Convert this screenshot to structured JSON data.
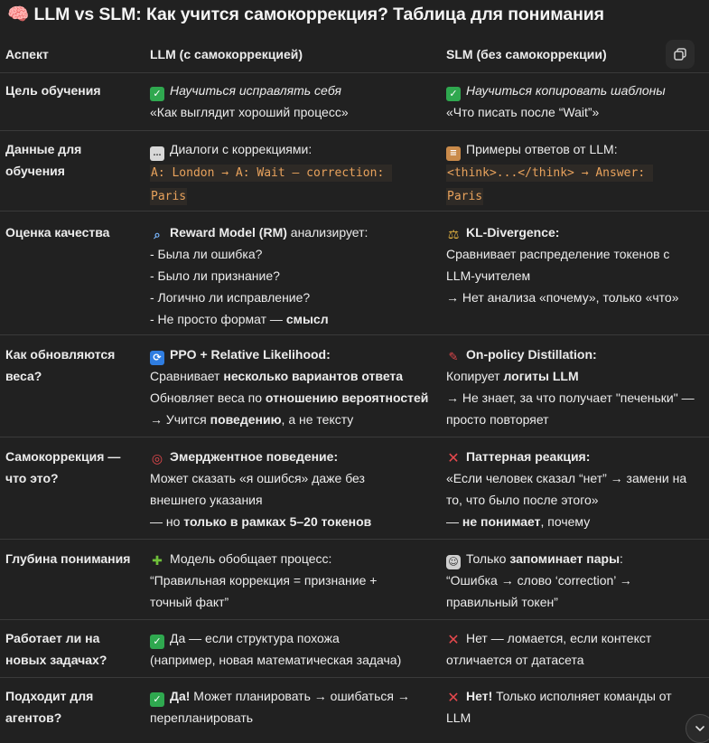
{
  "title": "🧠 LLM vs SLM: Как учится самокоррекция? Таблица для понимания",
  "header": {
    "aspect": "Аспект",
    "llm": "LLM (с самокоррекцией)",
    "slm": "SLM (без самокоррекции)"
  },
  "icons": {
    "copy": "copy-icon",
    "scroll_down": "chevron-down-icon"
  },
  "rows": [
    {
      "aspect": [
        "Цель обучения"
      ],
      "llm": {
        "icon": "✓",
        "line1": "Научиться исправлять себя",
        "line2": "«Как выглядит хороший процесс»"
      },
      "slm": {
        "icon": "✓",
        "line1": "Научиться копировать шаблоны",
        "line2": "«Что писать после “Wait”»"
      }
    },
    {
      "aspect": [
        "Данные для",
        "обучения"
      ],
      "llm": {
        "icon": "…",
        "line1": "Диалоги с коррекциями:",
        "code1": "A: London → A: Wait — correction: ",
        "code2": "Paris"
      },
      "slm": {
        "icon": "≡",
        "line1": "Примеры ответов от LLM:",
        "code1": "<think>...</think> → Answer: ",
        "code2": "Paris"
      }
    },
    {
      "aspect": [
        "Оценка качества"
      ],
      "llm": {
        "icon": "⌕",
        "head_bold": "Reward Model (RM)",
        "head_rest": " анализирует:",
        "l2": "- Была ли ошибка?",
        "l3": "- Было ли признание?",
        "l4": "- Логично ли исправление?",
        "l5a": "- Не просто формат — ",
        "l5b": "смысл"
      },
      "slm": {
        "icon": "⚖",
        "head_bold": "KL-Divergence:",
        "l2": "Сравнивает распределение токенов с",
        "l3": "LLM-учителем",
        "l4": "→ Нет анализа «почему», только «что»"
      }
    },
    {
      "aspect": [
        "Как обновляются",
        "веса?"
      ],
      "llm": {
        "icon": "⟳",
        "head_bold": "PPO + Relative Likelihood:",
        "l2a": "Сравнивает ",
        "l2b": "несколько вариантов ответа",
        "l3a": "Обновляет веса по ",
        "l3b": "отношению вероятностей",
        "l4a": "→ Учится ",
        "l4b": "поведению",
        "l4c": ", а не тексту"
      },
      "slm": {
        "icon": "✎",
        "head_bold": "On-policy Distillation:",
        "l2a": "Копирует ",
        "l2b": "логиты LLM",
        "l3": "→ Не знает, за что получает \"печеньки\" —",
        "l4": "просто повторяет"
      }
    },
    {
      "aspect": [
        "Самокоррекция —",
        "что это?"
      ],
      "llm": {
        "icon": "◎",
        "head_bold": "Эмерджентное поведение:",
        "l2": "Может сказать «я ошибся» даже без",
        "l3": "внешнего указания",
        "l4a": "— но ",
        "l4b": "только в рамках 5–20 токенов"
      },
      "slm": {
        "icon": "✕",
        "head_bold": "Паттерная реакция:",
        "l2": "«Если человек сказал “нет” → замени на",
        "l3": "то, что было после этого»",
        "l4a": "— ",
        "l4b": "не понимает",
        "l4c": ", почему"
      }
    },
    {
      "aspect": [
        "Глубина понимания"
      ],
      "llm": {
        "icon": "✚",
        "line1": "Модель обобщает процесс:",
        "l2": "“Правильная коррекция = признание +",
        "l3": "точный факт”"
      },
      "slm": {
        "icon": "☺",
        "line1a": "Только ",
        "line1b": "запоминает пары",
        "line1c": ":",
        "l2": "“Ошибка → слово ‘correction’ →",
        "l3": "правильный токен”"
      }
    },
    {
      "aspect": [
        "Работает ли на",
        "новых задачах?"
      ],
      "llm": {
        "icon": "✓",
        "line1": "Да — если структура похожа",
        "l2": "(например, новая математическая задача)"
      },
      "slm": {
        "icon": "✕",
        "line1": "Нет — ломается, если контекст",
        "l2": "отличается от датасета"
      }
    },
    {
      "aspect": [
        "Подходит для",
        "агентов?"
      ],
      "llm": {
        "icon": "✓",
        "line1b": "Да!",
        "line1c": " Может планировать → ошибаться →",
        "l2": "перепланировать"
      },
      "slm": {
        "icon": "✕",
        "line1b": "Нет!",
        "line1c": " Только исполняет команды от",
        "l2": "LLM"
      }
    }
  ]
}
